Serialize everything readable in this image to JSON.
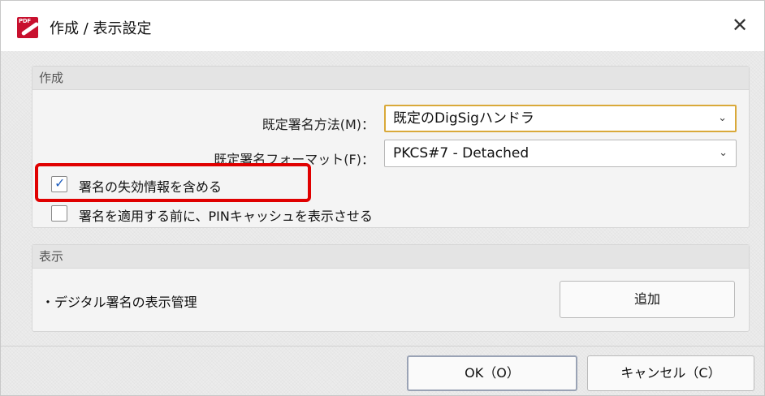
{
  "window": {
    "title": "作成 / 表示設定",
    "app_icon_text": "PDF",
    "close_symbol": "✕"
  },
  "create_group": {
    "header": "作成",
    "method_label": "既定署名方法(M)：",
    "method_value": "既定のDigSigハンドラ",
    "format_label": "既定署名フォーマット(F)：",
    "format_value": "PKCS#7 - Detached",
    "include_revocation": {
      "label": "署名の失効情報を含める",
      "checked": true
    },
    "show_pin_cache": {
      "label": "署名を適用する前に、PINキャッシュを表示させる",
      "checked": false
    }
  },
  "display_group": {
    "header": "表示",
    "item_label": "・デジタル署名の表示管理",
    "add_button": "追加"
  },
  "footer": {
    "ok_button": "OK（O）",
    "cancel_button": "キャンセル（C）"
  },
  "colors": {
    "highlight": "#e00000",
    "accent_focus": "#d9a93a",
    "check_tick": "#1f5fbf",
    "app_icon": "#c8102e"
  },
  "icons": {
    "chevron": "chevron-down-icon",
    "check": "check-icon",
    "close": "close-icon"
  }
}
